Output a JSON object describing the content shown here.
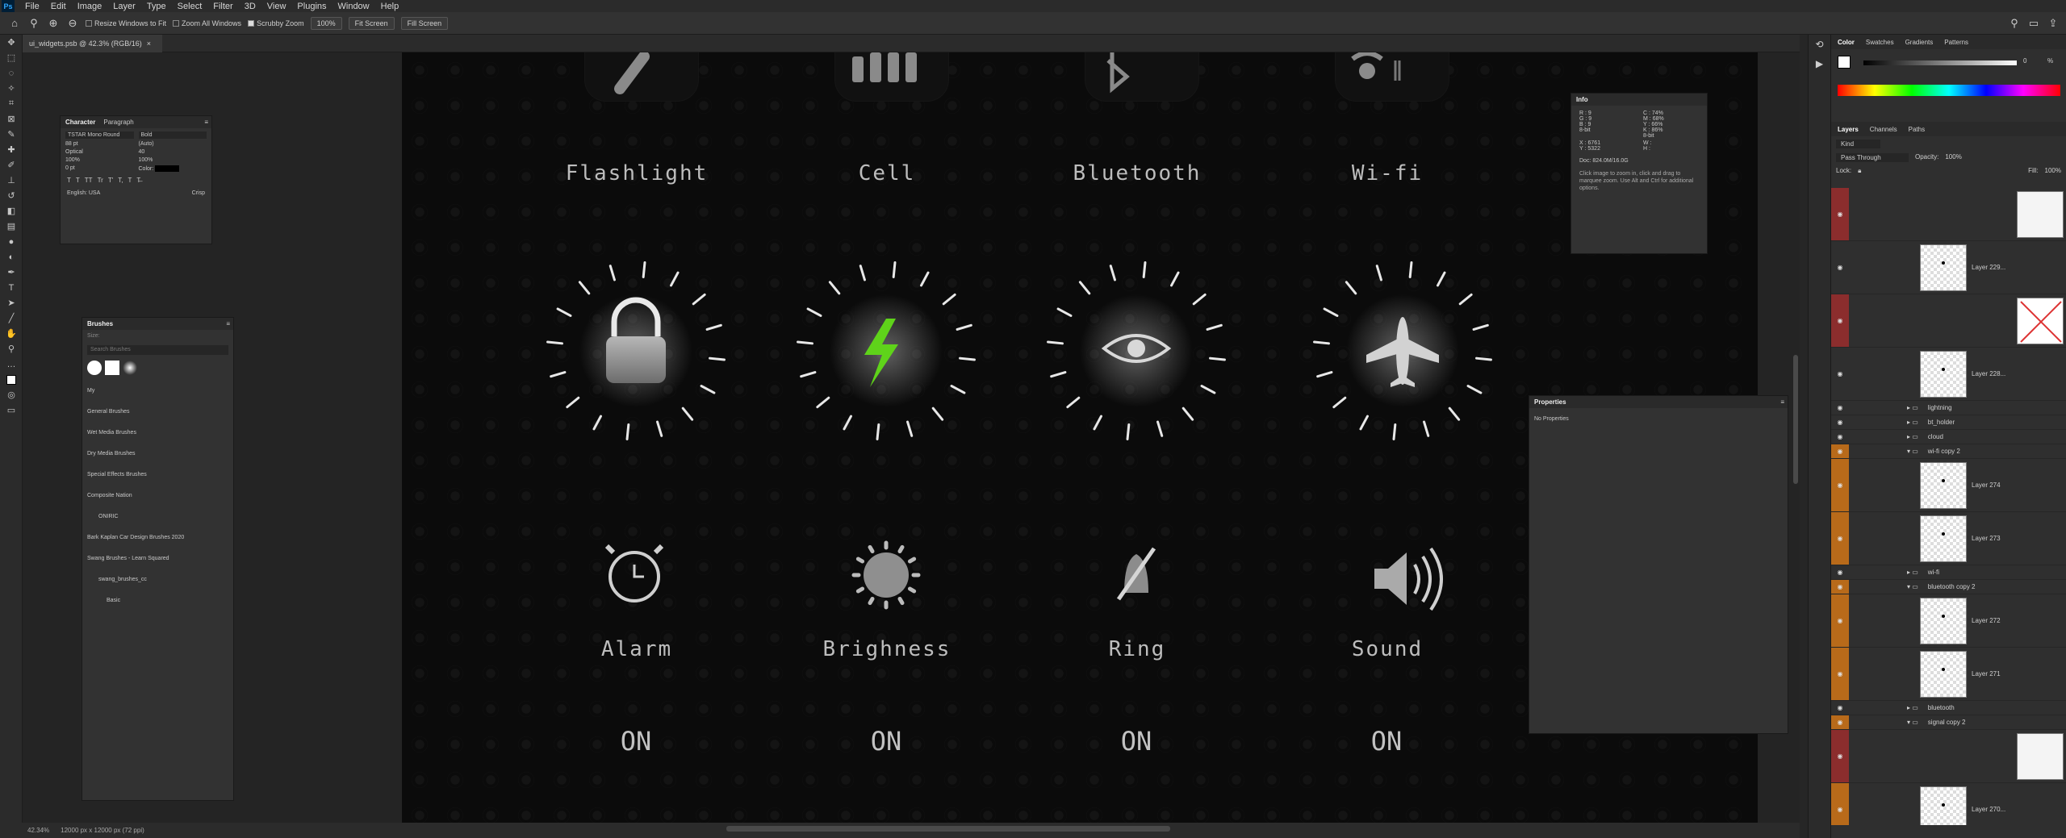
{
  "app": {
    "logo": "Ps"
  },
  "menu": [
    "File",
    "Edit",
    "Image",
    "Layer",
    "Type",
    "Select",
    "Filter",
    "3D",
    "View",
    "Plugins",
    "Window",
    "Help"
  ],
  "options": {
    "resize_windows": "Resize Windows to Fit",
    "zoom_all": "Zoom All Windows",
    "scrubby": "Scrubby Zoom",
    "zoom_value": "100%",
    "fit_screen": "Fit Screen",
    "fill_screen": "Fill Screen"
  },
  "document": {
    "tab_title": "ui_widgets.psb @ 42.3% (RGB/16)"
  },
  "canvas": {
    "top_labels": [
      "Flashlight",
      "Cell",
      "Bluetooth",
      "Wi-fi"
    ],
    "bottom_labels": [
      "Alarm",
      "Brighness",
      "Ring",
      "Sound"
    ],
    "on_labels": [
      "ON",
      "ON",
      "ON",
      "ON"
    ],
    "lightning_color": "#5fd31a",
    "icons_top": [
      "flashlight-icon",
      "cell-signal-icon",
      "bluetooth-icon",
      "wifi-icon"
    ],
    "icons_mid": [
      "lock-icon",
      "lightning-icon",
      "eye-icon",
      "airplane-icon"
    ],
    "icons_bottom": [
      "alarm-icon",
      "brightness-icon",
      "ring-muted-icon",
      "sound-icon"
    ]
  },
  "character": {
    "tabs": [
      "Character",
      "Paragraph"
    ],
    "font_family": "TSTAR Mono Round",
    "font_style": "Bold",
    "size": "88 pt",
    "leading": "(Auto)",
    "kerning": "Optical",
    "tracking": "40",
    "vscale": "100%",
    "hscale": "100%",
    "baseline": "0 pt",
    "color_label": "Color:",
    "glyphs": [
      "T",
      "T",
      "TT",
      "Tr",
      "T'",
      "T,",
      "T",
      "T̶"
    ],
    "language": "English: USA",
    "antialias": "Crisp"
  },
  "brushes": {
    "title": "Brushes",
    "size_label": "Size:",
    "search_placeholder": "Search Brushes",
    "groups": [
      "My",
      "General Brushes",
      "Wet Media Brushes",
      "Dry Media Brushes",
      "Special Effects Brushes",
      "Composite Nation",
      "ONIRIC",
      "Bark Kaplan Car Design Brushes 2020",
      "Swang Brushes - Learn Squared",
      "swang_brushes_cc",
      "Basic"
    ]
  },
  "info": {
    "title": "Info",
    "rgb": [
      "R :",
      "G :",
      "B :"
    ],
    "rgb_values": [
      "9",
      "9",
      "9"
    ],
    "cmyk": [
      "C :",
      "M :",
      "Y :",
      "K :"
    ],
    "cmyk_values": [
      "74%",
      "68%",
      "66%",
      "86%"
    ],
    "bit_left": "8-bit",
    "bit_right": "8-bit",
    "xy_labels": [
      "X :",
      "Y :"
    ],
    "xy_values": [
      "6761",
      "5322"
    ],
    "wh_labels": [
      "W :",
      "H :"
    ],
    "doc": "Doc: 824.0M/16.0G",
    "hint": "Click image to zoom in, click and drag to marquee zoom. Use Alt and Ctrl for additional options."
  },
  "properties": {
    "title": "Properties",
    "empty": "No Properties"
  },
  "color_panel": {
    "tabs": [
      "Color",
      "Swatches",
      "Gradients",
      "Patterns"
    ],
    "value": "0",
    "pct": "%"
  },
  "layers_panel": {
    "tabs": [
      "Layers",
      "Channels",
      "Paths"
    ],
    "filter": "Kind",
    "blend": "Pass Through",
    "opacity_label": "Opacity:",
    "opacity": "100%",
    "lock_label": "Lock:",
    "fill_label": "Fill:",
    "fill": "100%",
    "rows": [
      {
        "name": "",
        "kind": "mask-white",
        "color": "#8b2d2d"
      },
      {
        "name": "Layer 229...",
        "kind": "layer",
        "color": ""
      },
      {
        "name": "",
        "kind": "mask-x",
        "color": "#8b2d2d"
      },
      {
        "name": "Layer 228...",
        "kind": "layer",
        "color": ""
      },
      {
        "name": "lightning",
        "kind": "group",
        "color": ""
      },
      {
        "name": "bt_holder",
        "kind": "group",
        "color": ""
      },
      {
        "name": "cloud",
        "kind": "group",
        "color": ""
      },
      {
        "name": "wi-fi copy 2",
        "kind": "group-open",
        "color": "#b86a1a"
      },
      {
        "name": "Layer 274",
        "kind": "layer",
        "color": "#b86a1a"
      },
      {
        "name": "Layer 273",
        "kind": "layer",
        "color": "#b86a1a"
      },
      {
        "name": "wi-fi",
        "kind": "group",
        "color": ""
      },
      {
        "name": "bluetooth copy 2",
        "kind": "group-open",
        "color": "#b86a1a"
      },
      {
        "name": "Layer 272",
        "kind": "layer",
        "color": "#b86a1a"
      },
      {
        "name": "Layer 271",
        "kind": "layer",
        "color": "#b86a1a"
      },
      {
        "name": "bluetooth",
        "kind": "group",
        "color": ""
      },
      {
        "name": "signal copy 2",
        "kind": "group-open",
        "color": "#b86a1a"
      },
      {
        "name": "",
        "kind": "mask-white",
        "color": "#8b2d2d"
      },
      {
        "name": "Layer 270...",
        "kind": "layer",
        "color": "#b86a1a"
      }
    ]
  },
  "status": {
    "zoom": "42.34%",
    "doc_size": "12000 px x 12000 px (72 ppi)"
  }
}
